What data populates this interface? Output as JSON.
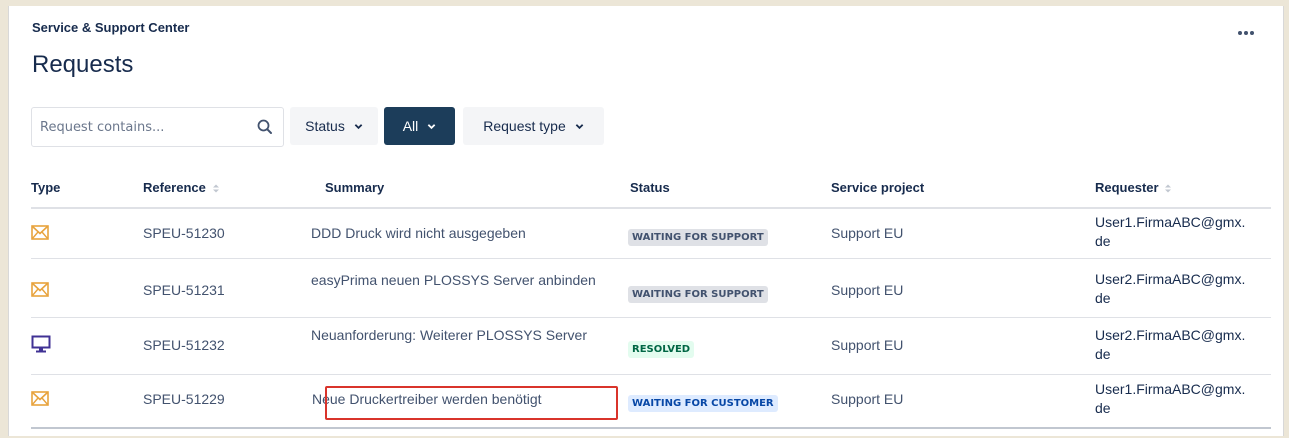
{
  "header": {
    "portal_name": "Service & Support Center",
    "page_title": "Requests"
  },
  "filters": {
    "search_placeholder": "Request contains...",
    "status_label": "Status",
    "scope_label": "All",
    "request_type_label": "Request type"
  },
  "table": {
    "columns": [
      "Type",
      "Reference",
      "Summary",
      "Status",
      "Service project",
      "Requester"
    ],
    "rows": [
      {
        "type_icon": "envelope-icon",
        "reference": "SPEU-51230",
        "summary": "DDD Druck wird nicht ausgegeben",
        "status": "WAITING FOR SUPPORT",
        "service_project": "Support EU",
        "requester_line1": "User1.FirmaABC@gmx.",
        "requester_line2": "de"
      },
      {
        "type_icon": "envelope-icon",
        "reference": "SPEU-51231",
        "summary": "easyPrima neuen PLOSSYS Server anbinden",
        "status": "WAITING FOR SUPPORT",
        "service_project": "Support EU",
        "requester_line1": "User2.FirmaABC@gmx.",
        "requester_line2": "de"
      },
      {
        "type_icon": "monitor-icon",
        "reference": "SPEU-51232",
        "summary": "Neuanforderung: Weiterer PLOSSYS Server",
        "status": "RESOLVED",
        "service_project": "Support EU",
        "requester_line1": "User2.FirmaABC@gmx.",
        "requester_line2": "de"
      },
      {
        "type_icon": "envelope-icon",
        "reference": "SPEU-51229",
        "summary": "Neue Druckertreiber werden benötigt",
        "status": "WAITING FOR CUSTOMER",
        "service_project": "Support EU",
        "requester_line1": "User1.FirmaABC@gmx.",
        "requester_line2": "de"
      }
    ]
  },
  "colors": {
    "envelope_icon": "#e8a33d",
    "monitor_icon": "#403294",
    "selected_filter": "#1c3d5a",
    "highlight": "#d9342b"
  }
}
